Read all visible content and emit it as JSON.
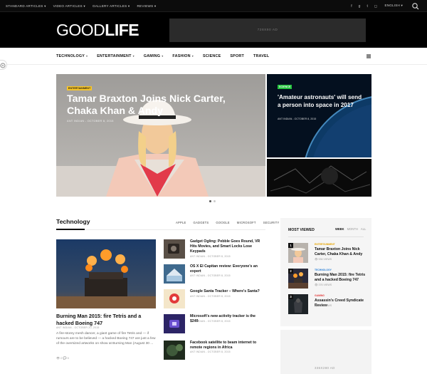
{
  "topbar": {
    "nav": [
      "STANDARD ARTICLES ▾",
      "VIDEO ARTICLES ▾",
      "GALLERY ARTICLES ▾",
      "REVIEWS ▾"
    ],
    "social_icons": [
      "facebook-icon",
      "google-plus-icon",
      "twitter-icon",
      "instagram-icon"
    ],
    "language": "ENGLISH ▾"
  },
  "header": {
    "logo_part1": "GOOD",
    "logo_part2": "LIFE",
    "ad_label": "728X90 AD"
  },
  "mainnav": {
    "items": [
      "TECHNOLOGY",
      "ENTERTAINMENT",
      "GAMING",
      "FASHION",
      "SCIENCE",
      "SPORT",
      "TRAVEL"
    ],
    "dropdown_marker": "▾"
  },
  "featured": {
    "main": {
      "badge": "ENTERTAINMENT",
      "title": "Tamar Braxton Joins Nick Carter, Chaka Khan & Andy",
      "meta": "ANT INDIAN  -  OCTOBER 8, 2015"
    },
    "side": {
      "badge": "SCIENCE",
      "title": "'Amateur astronauts' will send a person into space in 2017",
      "meta": "ANT INDIAN  -  OCTOBER 8, 2015"
    }
  },
  "technology": {
    "title": "Technology",
    "tabs": [
      "APPLE",
      "GADGETS",
      "GOOGLE",
      "MICROSOFT",
      "SECURITY"
    ],
    "main": {
      "title": "Burning Man 2015: fire Tetris and a hacked Boeing 747",
      "meta": "ANT INDIAN  -  OCTOBER 20, 2015",
      "excerpt": "A fire-storey mesh dancer, a giant game of fire Tetris and — if rumours are to be believed — a hacked Boeing 747 are just a few of the oversized artworks on show at Burning Man (August 30 ...",
      "counts": "👁 0  💬 0"
    },
    "list": [
      {
        "title": "Gadget Ogling: Pebble Goes Round, VR Hits Movies, and Smart Locks Lose Keypads",
        "meta": "ANT INDIAN  -  OCTOBER 8, 2015"
      },
      {
        "title": "OS X El Capitan review: Everyone's an expert",
        "meta": "ANT INDIAN  -  OCTOBER 8, 2015"
      },
      {
        "title": "Google Santa Tracker – Where's Santa?",
        "meta": "ANT INDIAN  -  OCTOBER 8, 2015"
      },
      {
        "title": "Microsoft's new activity tracker is the $249",
        "meta": "ANT INDIAN  -  OCTOBER 8, 2015"
      },
      {
        "title": "Facebook satellite to beam internet to remote regions in Africa",
        "meta": "ANT INDIAN  -  OCTOBER 8, 2015"
      }
    ]
  },
  "sidebar": {
    "title": "MOST VIEWED",
    "tabs": [
      "WEEK",
      "MONTH",
      "ALL"
    ],
    "items": [
      {
        "num": "1",
        "cat": "ENTERTAINMENT",
        "cat_color": "#e6a400",
        "title": "Tamar Braxton Joins Nick Carter, Chaka Khan & Andy",
        "views": "👁 936 VIEWS"
      },
      {
        "num": "2",
        "cat": "TECHNOLOGY",
        "cat_color": "#2a7fd6",
        "title": "Burning Man 2015: fire Tetris and a hacked Boeing 747",
        "views": "👁 376 VIEWS"
      },
      {
        "num": "3",
        "cat": "GAMING",
        "cat_color": "#e23d3d",
        "title": "Assassin's Creed Syndicate Review",
        "views": "👁 336 VIEWS"
      }
    ],
    "ad_label": "336X280 AD"
  },
  "colors": {
    "accent_yellow": "#f5c42c",
    "science_green": "#24c23e",
    "header_bg": "#000000"
  }
}
